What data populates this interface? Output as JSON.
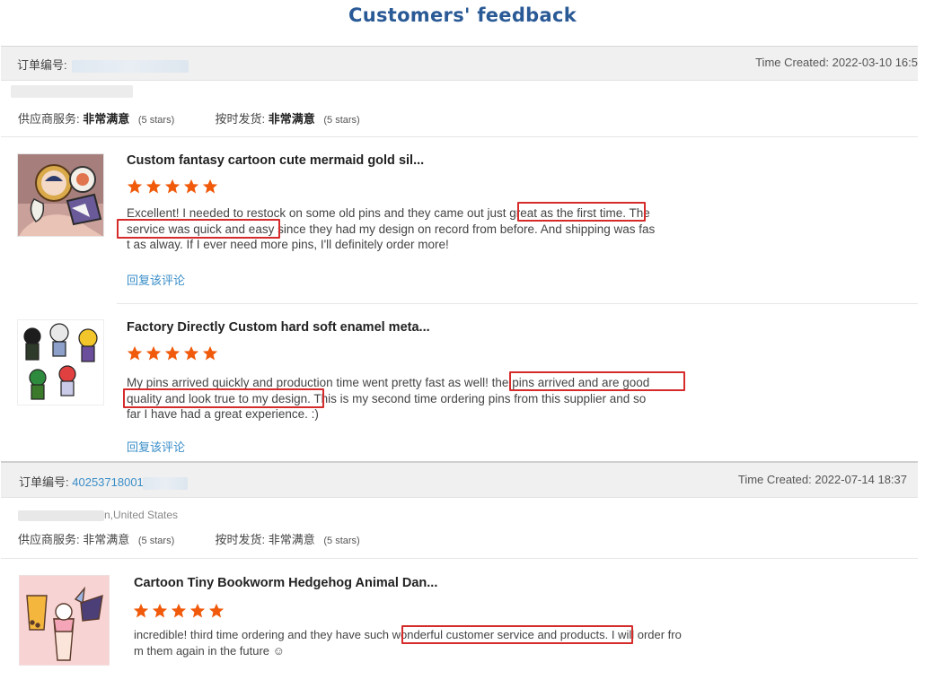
{
  "page": {
    "title": "Customers' feedback"
  },
  "orders": [
    {
      "order_label": "订单编号:",
      "order_number": "",
      "time_created": "Time Created: 2022-03-10 16:5",
      "buyer_location": "",
      "supplier_service_label": "供应商服务:",
      "supplier_service_value": "非常满意",
      "supplier_service_stars": "(5 stars)",
      "on_time_label": "按时发货:",
      "on_time_value": "非常满意",
      "on_time_stars": "(5 stars)",
      "items": [
        {
          "title": "Custom fantasy cartoon cute mermaid gold sil...",
          "rating": 5,
          "review_lines": [
            "Excellent! I needed to restock on some old pins and they came out just great as the first time. The",
            "service was quick and easy since they had my design on record from before. And shipping was fas",
            "t as alway. If I ever need more pins, I'll definitely order more!"
          ],
          "reply_label": "回复该评论"
        },
        {
          "title": "Factory Directly Custom hard soft enamel meta...",
          "rating": 5,
          "review_lines": [
            "My pins arrived quickly and production time went pretty fast as well! the pins arrived and are good",
            "quality and look true to my design. This is my second time ordering pins from this supplier and so",
            "far I have had a great experience. :)"
          ],
          "reply_label": "回复该评论"
        }
      ]
    },
    {
      "order_label": "订单编号:",
      "order_number": "40253718001",
      "time_created": "Time Created: 2022-07-14 18:37",
      "buyer_location": "n,United States",
      "supplier_service_label": "供应商服务:",
      "supplier_service_value": "非常满意",
      "supplier_service_stars": "(5 stars)",
      "on_time_label": "按时发货:",
      "on_time_value": "非常满意",
      "on_time_stars": "(5 stars)",
      "items": [
        {
          "title": "Cartoon Tiny Bookworm Hedgehog Animal Dan...",
          "rating": 5,
          "review_lines": [
            "incredible! third time ordering and they have such wonderful customer service and products. I will order fro",
            "m them again in the future ☺"
          ]
        }
      ]
    }
  ],
  "colors": {
    "title": "#2a5a96",
    "link": "#3a8ec8",
    "star": "#f05a0a",
    "highlight": "#d52b2b",
    "header_bg": "#f0f0f0"
  },
  "icons": [
    "star-icon",
    "product-thumbnail-mermaid-pins",
    "product-thumbnail-anime-pins",
    "product-thumbnail-bubble-tea-pins"
  ]
}
